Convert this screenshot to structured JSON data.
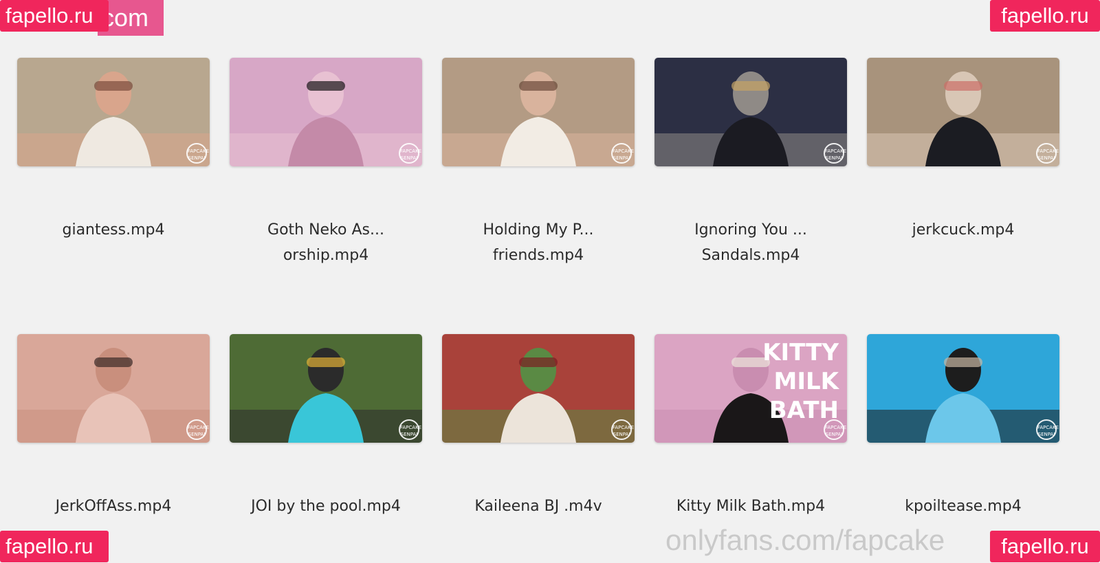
{
  "watermarks": {
    "brand": "fapello.ru",
    "header_fragment": "com",
    "footer_url": "onlyfans.com/fapcake"
  },
  "videos": [
    {
      "line1": "giantess.mp4",
      "line2": "",
      "badge": "FAPCAKE SENPAI",
      "palette": [
        "#b8a78f",
        "#efe9e1",
        "#7a4b3c",
        "#d9a58c"
      ]
    },
    {
      "line1": "Goth Neko As...",
      "line2": "orship.mp4",
      "badge": "FAPCAKE SENPAI",
      "palette": [
        "#d7a7c6",
        "#c48aa8",
        "#1a1618",
        "#e8c1d2"
      ]
    },
    {
      "line1": "Holding My P...",
      "line2": "friends.mp4",
      "badge": "FAPCAKE SENPAI",
      "palette": [
        "#b39b84",
        "#f2ece4",
        "#6b4a3a",
        "#d9b39d"
      ]
    },
    {
      "line1": "Ignoring You ...",
      "line2": "Sandals.mp4",
      "badge": "FAPCAKE SENPAI",
      "palette": [
        "#2c2f44",
        "#1b1b22",
        "#c4a264",
        "#8f8a86"
      ]
    },
    {
      "line1": "jerkcuck.mp4",
      "line2": "",
      "badge": "FAPCAKE SENPAI",
      "palette": [
        "#a8937c",
        "#1b1c22",
        "#cc6e66",
        "#d8c6b5"
      ]
    },
    {
      "line1": "JerkOffAss.mp4",
      "line2": "",
      "badge": "FAPCAKE SENPAI",
      "palette": [
        "#d9a799",
        "#e8c3b8",
        "#3a2a26",
        "#c98f7d"
      ]
    },
    {
      "line1": "JOI by the pool.mp4",
      "line2": "",
      "badge": "FAPCAKE SENPAI",
      "palette": [
        "#4e6b35",
        "#39c6d8",
        "#e2b037",
        "#2b2b2b"
      ]
    },
    {
      "line1": "Kaileena BJ .m4v",
      "line2": "",
      "badge": "FAPCAKE SENPAI",
      "palette": [
        "#a9423a",
        "#ece4da",
        "#7b1e22",
        "#5a8a44"
      ]
    },
    {
      "line1": "Kitty Milk Bath.mp4",
      "line2": "",
      "badge": "FAPCAKE SENPAI",
      "palette": [
        "#dba4c3",
        "#1a1718",
        "#ece6dc",
        "#c98db0"
      ],
      "overlay_text": [
        "KITTY",
        "MILK",
        "BATH"
      ]
    },
    {
      "line1": "kpoiltease.mp4",
      "line2": "",
      "badge": "FAPCAKE SENPAI",
      "palette": [
        "#2ea6d9",
        "#6cc7ea",
        "#c9b8a4",
        "#1d1d1d"
      ]
    }
  ]
}
